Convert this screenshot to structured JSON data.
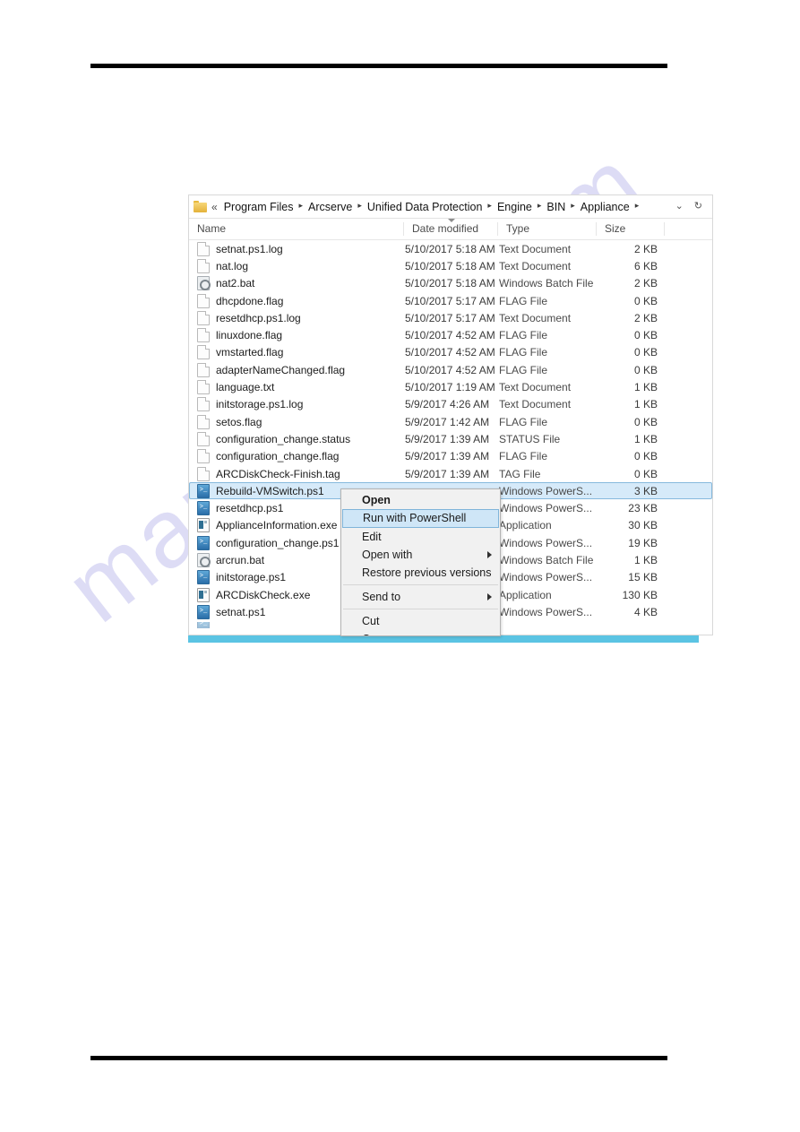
{
  "watermark": {
    "text": "manualslib.com"
  },
  "explorer": {
    "address": {
      "folder_icon": "folder-icon",
      "prefix": "«",
      "crumbs": [
        "Program Files",
        "Arcserve",
        "Unified Data Protection",
        "Engine",
        "BIN",
        "Appliance"
      ],
      "separator": "▸",
      "dropdown_icon": "chevron-down-icon",
      "refresh_icon": "refresh-icon",
      "dropdown_glyph": "⌄",
      "refresh_glyph": "↻"
    },
    "columns": {
      "name": "Name",
      "date_modified": "Date modified",
      "type": "Type",
      "size": "Size",
      "sorted_by": "Date modified",
      "sort_direction": "descending"
    },
    "files": [
      {
        "name": "setnat.ps1.log",
        "date": "5/10/2017 5:18 AM",
        "type": "Text Document",
        "size": "2 KB",
        "icon": "doc"
      },
      {
        "name": "nat.log",
        "date": "5/10/2017 5:18 AM",
        "type": "Text Document",
        "size": "6 KB",
        "icon": "doc"
      },
      {
        "name": "nat2.bat",
        "date": "5/10/2017 5:18 AM",
        "type": "Windows Batch File",
        "size": "2 KB",
        "icon": "bat"
      },
      {
        "name": "dhcpdone.flag",
        "date": "5/10/2017 5:17 AM",
        "type": "FLAG File",
        "size": "0 KB",
        "icon": "doc"
      },
      {
        "name": "resetdhcp.ps1.log",
        "date": "5/10/2017 5:17 AM",
        "type": "Text Document",
        "size": "2 KB",
        "icon": "doc"
      },
      {
        "name": "linuxdone.flag",
        "date": "5/10/2017 4:52 AM",
        "type": "FLAG File",
        "size": "0 KB",
        "icon": "doc"
      },
      {
        "name": "vmstarted.flag",
        "date": "5/10/2017 4:52 AM",
        "type": "FLAG File",
        "size": "0 KB",
        "icon": "doc"
      },
      {
        "name": "adapterNameChanged.flag",
        "date": "5/10/2017 4:52 AM",
        "type": "FLAG File",
        "size": "0 KB",
        "icon": "doc"
      },
      {
        "name": "language.txt",
        "date": "5/10/2017 1:19 AM",
        "type": "Text Document",
        "size": "1 KB",
        "icon": "doc"
      },
      {
        "name": "initstorage.ps1.log",
        "date": "5/9/2017 4:26 AM",
        "type": "Text Document",
        "size": "1 KB",
        "icon": "doc"
      },
      {
        "name": "setos.flag",
        "date": "5/9/2017 1:42 AM",
        "type": "FLAG File",
        "size": "0 KB",
        "icon": "doc"
      },
      {
        "name": "configuration_change.status",
        "date": "5/9/2017 1:39 AM",
        "type": "STATUS File",
        "size": "1 KB",
        "icon": "doc"
      },
      {
        "name": "configuration_change.flag",
        "date": "5/9/2017 1:39 AM",
        "type": "FLAG File",
        "size": "0 KB",
        "icon": "doc"
      },
      {
        "name": "ARCDiskCheck-Finish.tag",
        "date": "5/9/2017 1:39 AM",
        "type": "TAG File",
        "size": "0 KB",
        "icon": "doc"
      },
      {
        "name": "Rebuild-VMSwitch.ps1",
        "date": "",
        "type": "Windows PowerS...",
        "size": "3 KB",
        "icon": "ps",
        "selected": true
      },
      {
        "name": "resetdhcp.ps1",
        "date": "",
        "type": "Windows PowerS...",
        "size": "23 KB",
        "icon": "ps"
      },
      {
        "name": "ApplianceInformation.exe",
        "date": "",
        "type": "Application",
        "size": "30 KB",
        "icon": "exe"
      },
      {
        "name": "configuration_change.ps1",
        "date": "",
        "type": "Windows PowerS...",
        "size": "19 KB",
        "icon": "ps"
      },
      {
        "name": "arcrun.bat",
        "date": "",
        "type": "Windows Batch File",
        "size": "1 KB",
        "icon": "bat"
      },
      {
        "name": "initstorage.ps1",
        "date": "",
        "type": "Windows PowerS...",
        "size": "15 KB",
        "icon": "ps"
      },
      {
        "name": "ARCDiskCheck.exe",
        "date": "",
        "type": "Application",
        "size": "130 KB",
        "icon": "exe"
      },
      {
        "name": "setnat.ps1",
        "date": "",
        "type": "Windows PowerS...",
        "size": "4 KB",
        "icon": "ps"
      },
      {
        "name": "",
        "date": "",
        "type": "",
        "size": "",
        "icon": "ps",
        "clipped": true
      }
    ]
  },
  "context_menu": {
    "items": [
      {
        "label": "Open",
        "bold": true
      },
      {
        "label": "Run with PowerShell",
        "highlighted": true
      },
      {
        "label": "Edit"
      },
      {
        "label": "Open with",
        "submenu": true
      },
      {
        "label": "Restore previous versions"
      },
      {
        "separator": true
      },
      {
        "label": "Send to",
        "submenu": true
      },
      {
        "separator": true
      },
      {
        "label": "Cut"
      },
      {
        "label": "Copy"
      }
    ]
  },
  "colors": {
    "accent_teal": "#5bc4e3",
    "selection_fill": "#d6eaf9",
    "selection_border": "#86b9dd",
    "menu_highlight": "#cfe6f7",
    "watermark": "#c9c8ef"
  }
}
